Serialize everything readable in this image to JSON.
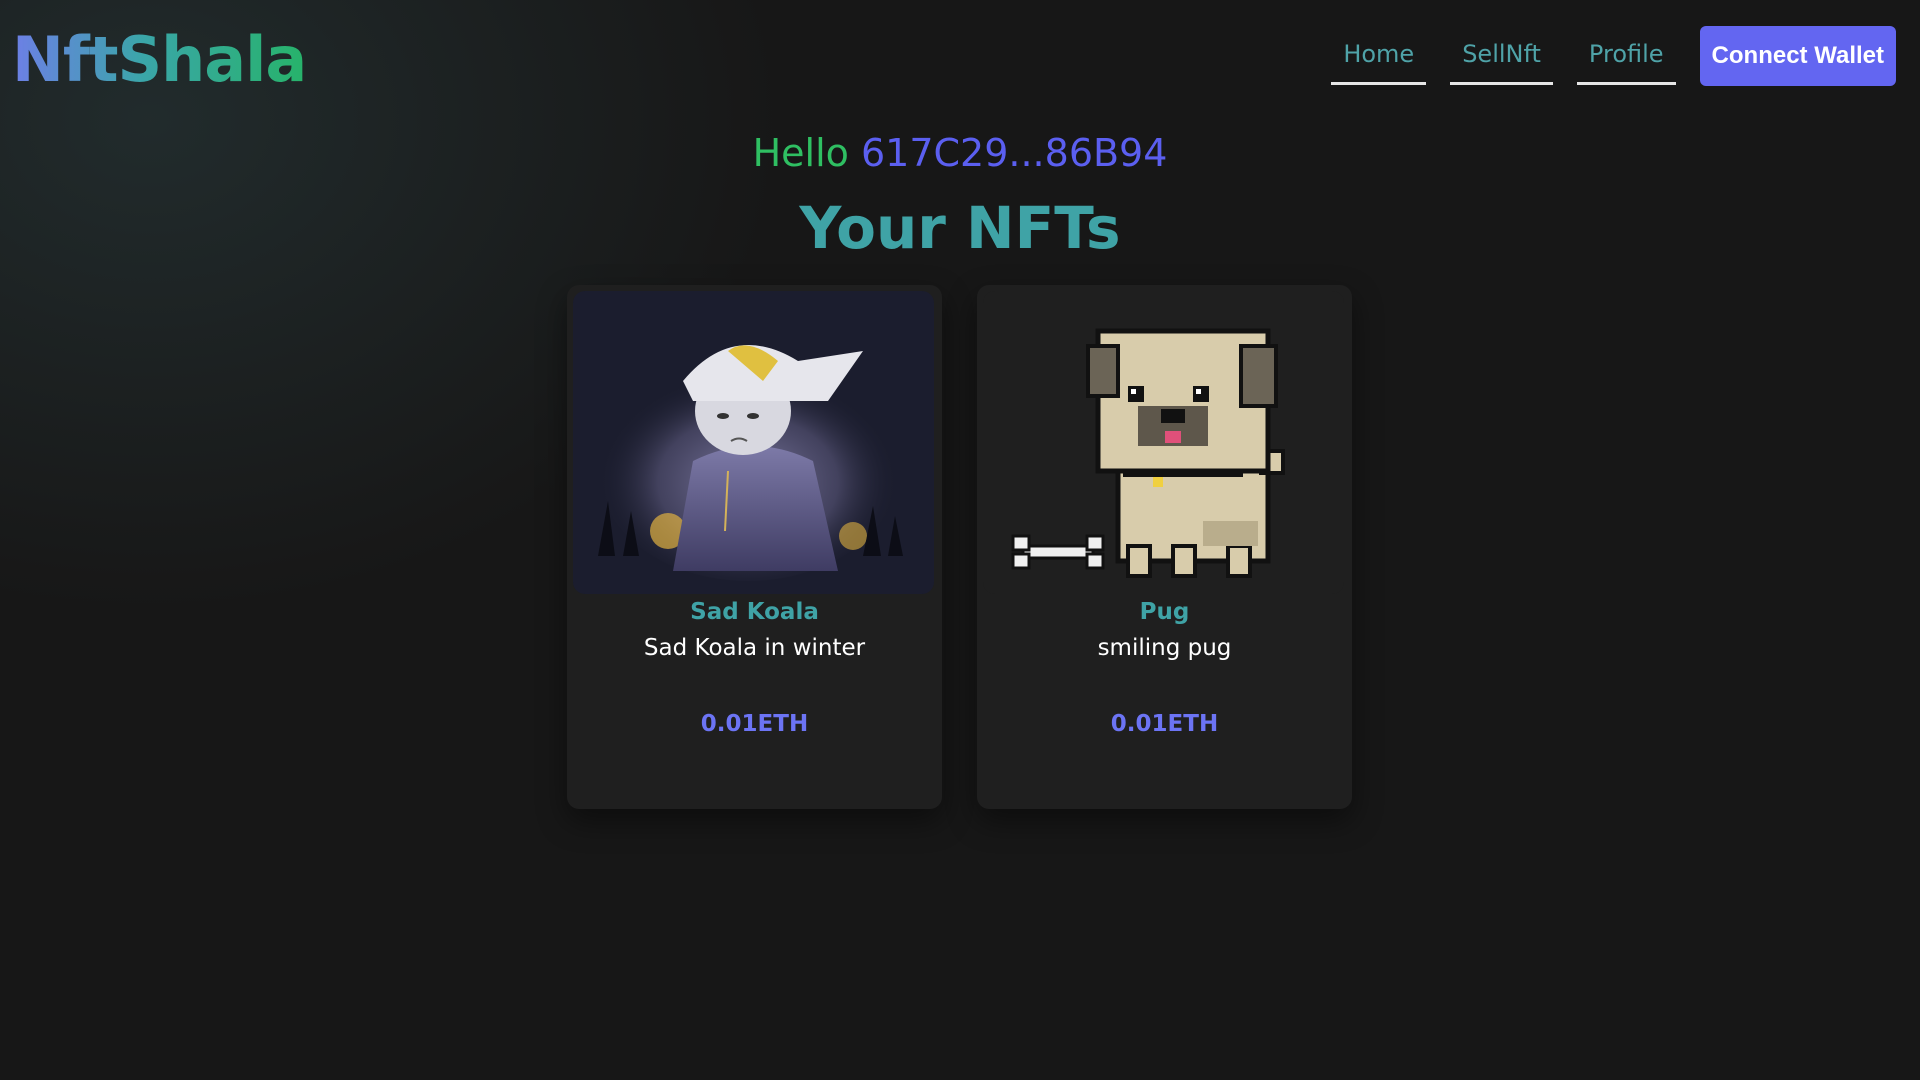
{
  "header": {
    "logo": "NftShala",
    "nav": [
      {
        "label": "Home"
      },
      {
        "label": "SellNft"
      },
      {
        "label": "Profile"
      }
    ],
    "connect_label": "Connect Wallet"
  },
  "greeting": {
    "hello": "Hello",
    "address": "617C29...86B94"
  },
  "page_title": "Your NFTs",
  "cards": [
    {
      "name": "Sad Koala",
      "description": "Sad Koala in winter",
      "price": "0.01ETH",
      "image_icon": "koala-hoodie-image"
    },
    {
      "name": "Pug",
      "description": "smiling pug",
      "price": "0.01ETH",
      "image_icon": "pixel-pug-image"
    }
  ],
  "colors": {
    "accent": "#6366f1",
    "teal": "#3fa3a6",
    "green": "#2fbf62",
    "background": "#171717"
  }
}
